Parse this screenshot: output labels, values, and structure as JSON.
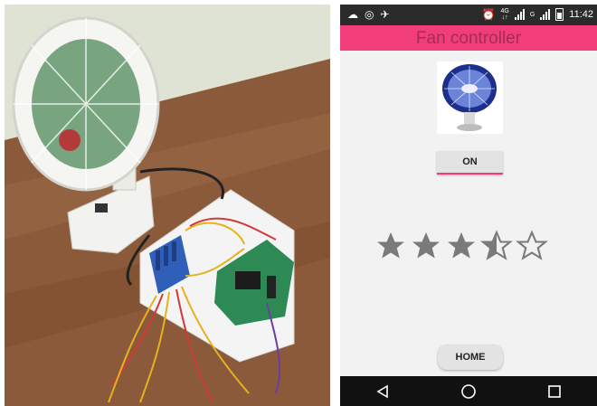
{
  "photo": {
    "description_icon": "photo-of-fan-and-relay-board",
    "colors": {
      "wall": "#dfe3d3",
      "table": "#8a5a3a",
      "fan_white": "#f2f2ee",
      "fan_blade": "#4d8a5a",
      "board": "#f4f4f4",
      "relay": "#2f5fb8",
      "pcb": "#2e8a55",
      "wire_red": "#d03a3a",
      "wire_yellow": "#e6b21e"
    }
  },
  "phone": {
    "status_bar": {
      "left_icons": [
        "cloud-icon",
        "hotspot-icon",
        "signal-x-icon"
      ],
      "alarm_icon": "alarm-icon",
      "net1": {
        "top": "4G",
        "bottom": "↓↑"
      },
      "net1_small": "4G",
      "net2_small": "G",
      "battery_icon": "battery-icon",
      "time": "11:42"
    },
    "app_bar": {
      "title": "Fan controller",
      "color": "#f23d7b"
    },
    "image": {
      "icon": "wall-fan-image"
    },
    "on_button": {
      "label": "ON"
    },
    "rating": {
      "value": 3.5,
      "max": 5,
      "filled_color": "#7a7a7a"
    },
    "home_button": {
      "label": "HOME"
    },
    "nav_bar": {
      "back_icon": "back-triangle-icon",
      "home_icon": "home-circle-icon",
      "recents_icon": "recents-square-icon"
    }
  }
}
